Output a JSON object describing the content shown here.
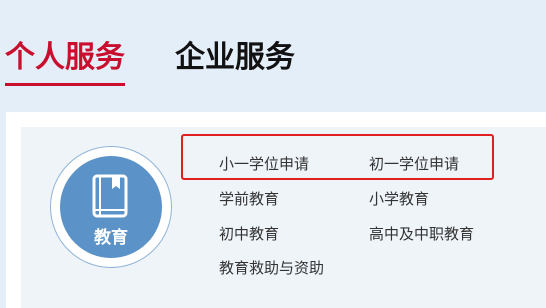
{
  "tabs": {
    "personal": "个人服务",
    "enterprise": "企业服务"
  },
  "category": {
    "label": "教育",
    "icon": "book-icon"
  },
  "links": [
    "小一学位申请",
    "初一学位申请",
    "学前教育",
    "小学教育",
    "初中教育",
    "高中及中职教育",
    "教育救助与资助"
  ],
  "colors": {
    "accent": "#c8102e",
    "badge": "#5b93c9",
    "highlight": "#e02020"
  }
}
